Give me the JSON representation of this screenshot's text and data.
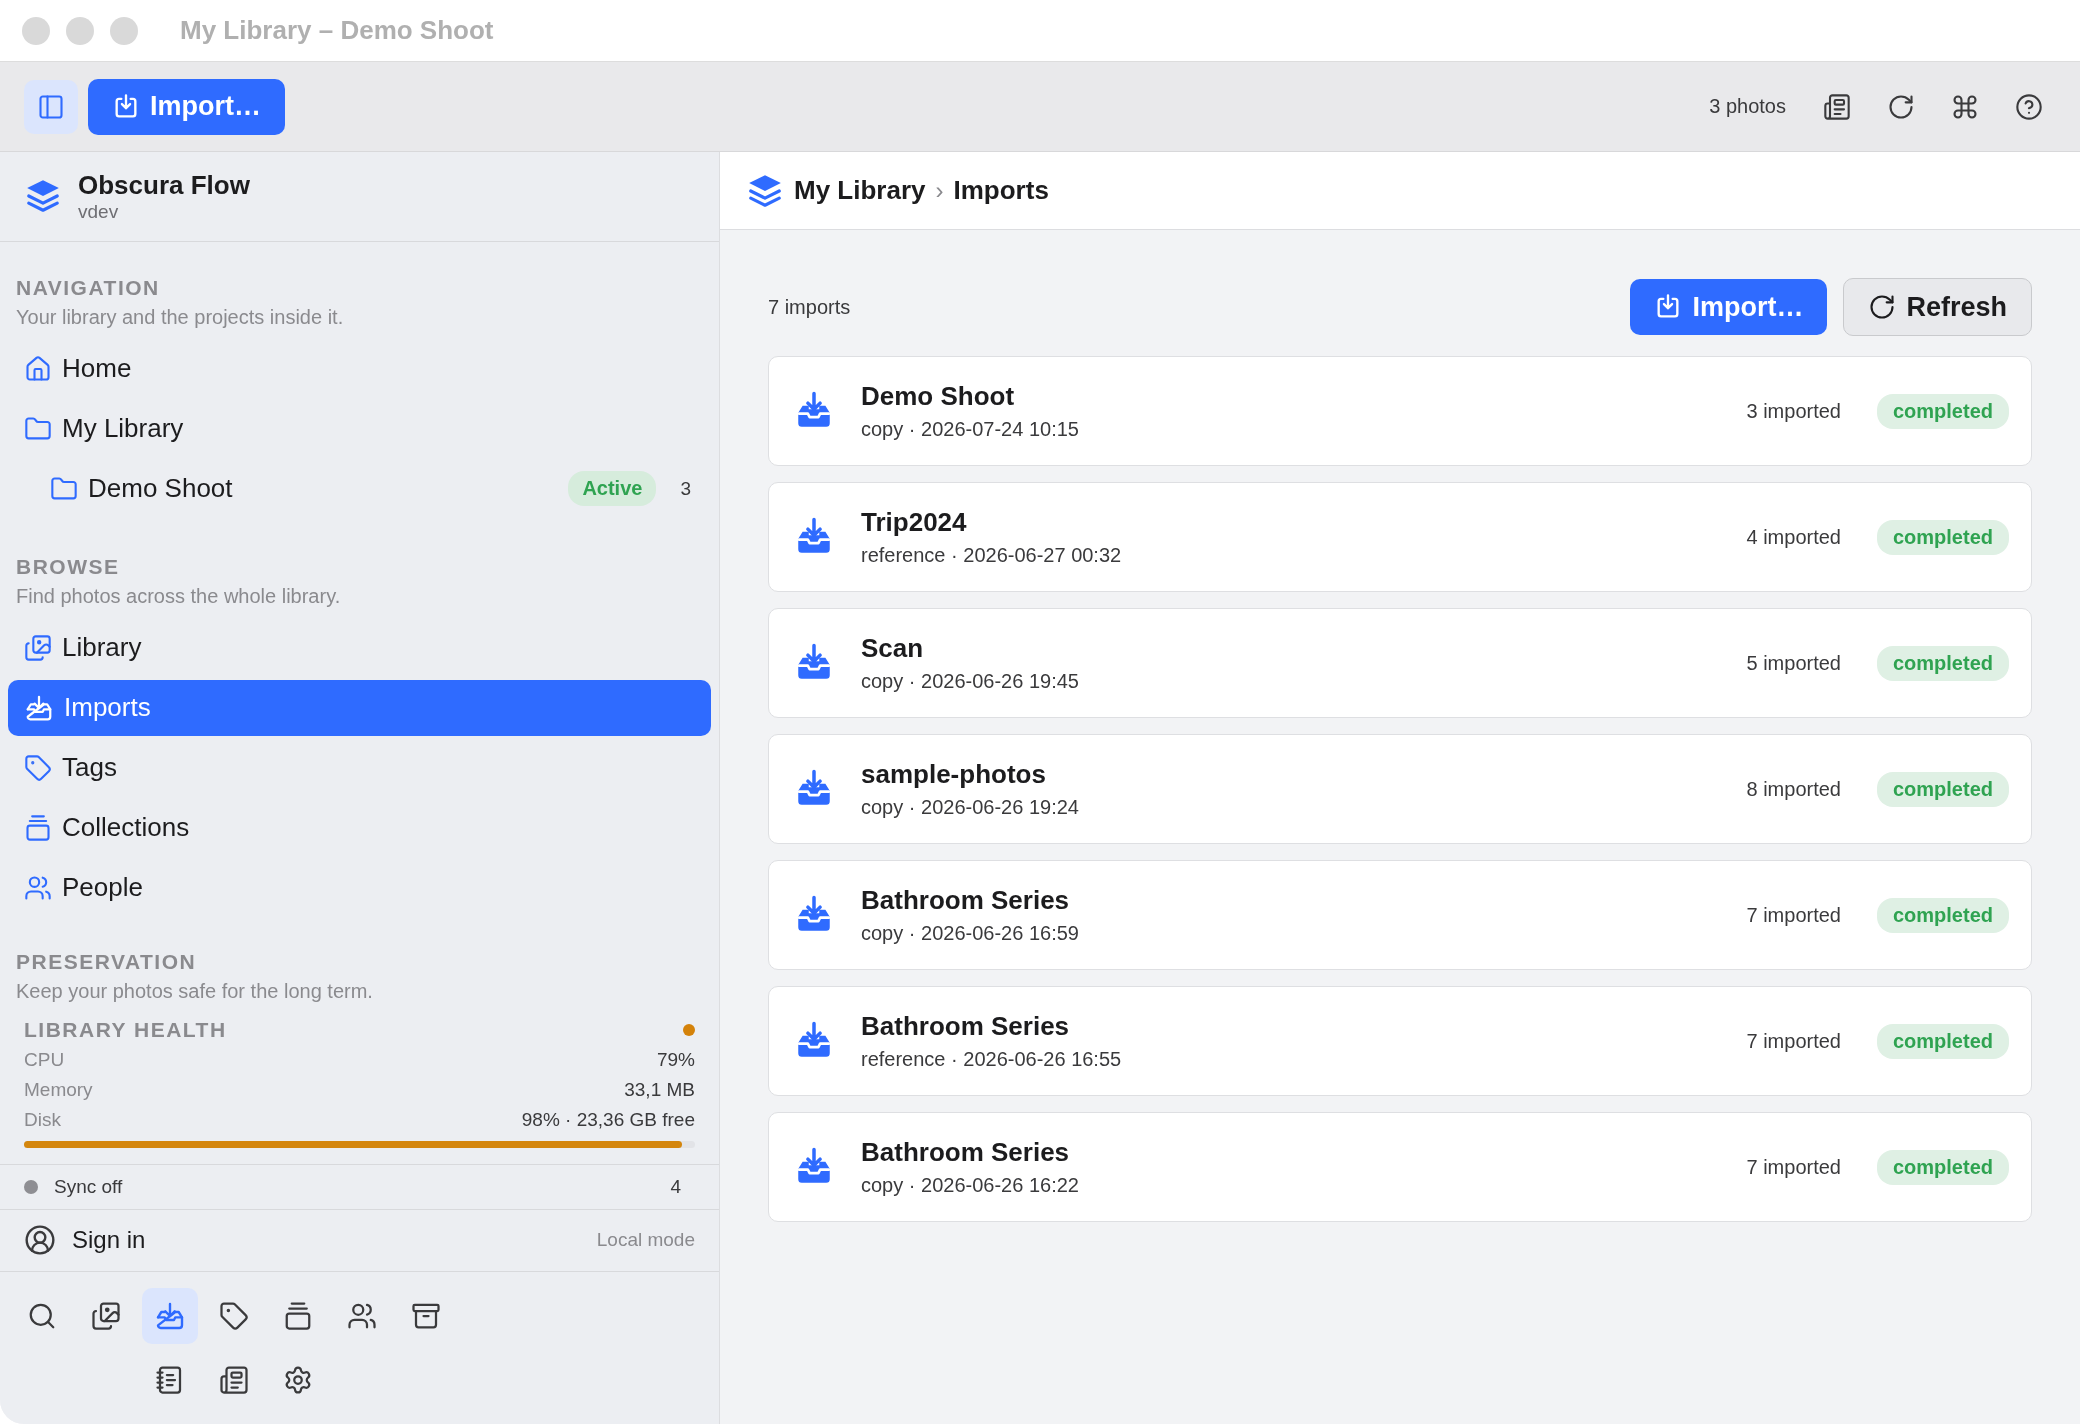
{
  "window": {
    "title": "My Library – Demo Shoot"
  },
  "toolbar": {
    "import_button": "Import…",
    "photo_count": "3 photos"
  },
  "sidebar": {
    "app_name": "Obscura Flow",
    "version": "vdev",
    "sections": [
      {
        "title": "NAVIGATION",
        "subtitle": "Your library and the projects inside it.",
        "items": [
          {
            "label": "Home",
            "selected": false
          },
          {
            "label": "My Library",
            "selected": false,
            "children": [
              {
                "label": "Demo Shoot",
                "selected": false,
                "badge": "Active",
                "count": "3"
              }
            ]
          }
        ]
      },
      {
        "title": "BROWSE",
        "subtitle": "Find photos across the whole library.",
        "items": [
          {
            "label": "Library",
            "selected": false
          },
          {
            "label": "Imports",
            "selected": true
          },
          {
            "label": "Tags",
            "selected": false
          },
          {
            "label": "Collections",
            "selected": false
          },
          {
            "label": "People",
            "selected": false
          }
        ]
      },
      {
        "title": "PRESERVATION",
        "subtitle": "Keep your photos safe for the long term."
      }
    ],
    "health": {
      "title": "LIBRARY HEALTH",
      "color": "#d4820a",
      "metrics": [
        {
          "label": "CPU",
          "value": "79%"
        },
        {
          "label": "Memory",
          "value": "33,1 MB"
        },
        {
          "label": "Disk",
          "value": "98% · 23,36 GB free"
        }
      ],
      "level": 0.98
    },
    "sync": {
      "label": "Sync off",
      "count": "4",
      "color": "#8e8e93"
    },
    "account": {
      "label": "Sign in",
      "mode": "Local mode"
    },
    "dock": [
      {
        "selected": false
      },
      {
        "selected": false
      },
      {
        "selected": true
      },
      {
        "selected": false
      },
      {
        "selected": false
      },
      {
        "selected": false
      },
      {
        "selected": false
      },
      {
        "selected": false
      },
      {
        "selected": false
      },
      {
        "selected": false
      }
    ]
  },
  "main": {
    "breadcrumb": [
      "My Library",
      "Imports"
    ],
    "separator": "›",
    "count": "7 imports",
    "import_button": "Import…",
    "refresh_button": "Refresh",
    "rows": [
      {
        "name": "Demo Shoot",
        "detail": "copy · 2026-07-24 10:15",
        "imported": "3 imported",
        "status": "completed"
      },
      {
        "name": "Trip2024",
        "detail": "reference · 2026-06-27 00:32",
        "imported": "4 imported",
        "status": "completed"
      },
      {
        "name": "Scan",
        "detail": "copy · 2026-06-26 19:45",
        "imported": "5 imported",
        "status": "completed"
      },
      {
        "name": "sample-photos",
        "detail": "copy · 2026-06-26 19:24",
        "imported": "8 imported",
        "status": "completed"
      },
      {
        "name": "Bathroom Series",
        "detail": "copy · 2026-06-26 16:59",
        "imported": "7 imported",
        "status": "completed"
      },
      {
        "name": "Bathroom Series",
        "detail": "reference · 2026-06-26 16:55",
        "imported": "7 imported",
        "status": "completed"
      },
      {
        "name": "Bathroom Series",
        "detail": "copy · 2026-06-26 16:22",
        "imported": "7 imported",
        "status": "completed"
      }
    ]
  }
}
